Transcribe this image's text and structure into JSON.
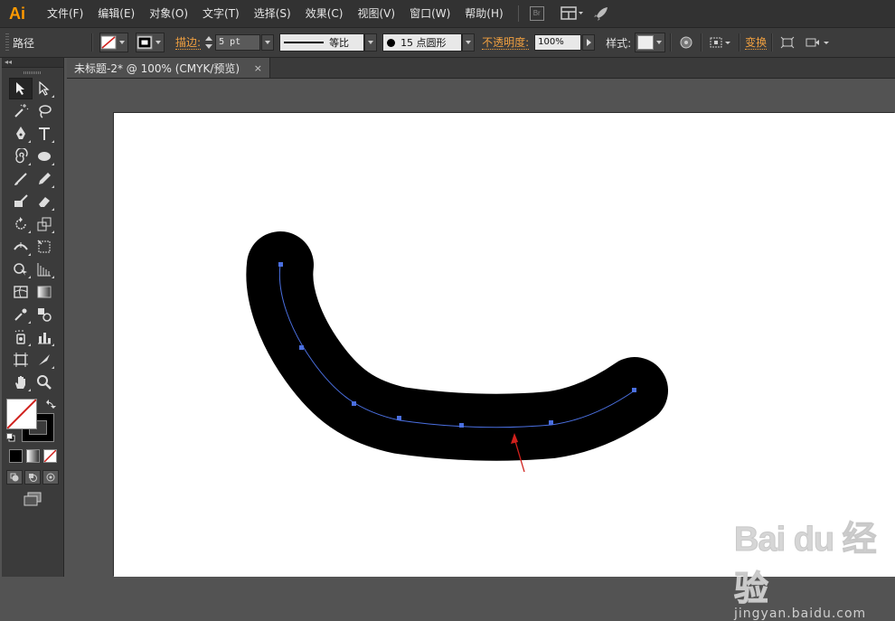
{
  "app": {
    "logo": "Ai"
  },
  "menu": [
    "文件(F)",
    "编辑(E)",
    "对象(O)",
    "文字(T)",
    "选择(S)",
    "效果(C)",
    "视图(V)",
    "窗口(W)",
    "帮助(H)"
  ],
  "menubar_buttons": {
    "bridge": "Br"
  },
  "control": {
    "selection_label": "路径",
    "stroke_label": "描边:",
    "stroke_value": "5 pt",
    "profile_label": "等比",
    "brush_label": "15 点圆形",
    "opacity_label": "不透明度:",
    "opacity_value": "100%",
    "style_label": "样式:",
    "transform_label": "变换"
  },
  "document": {
    "tab_title": "未标题-2* @ 100% (CMYK/预览)",
    "close": "×"
  },
  "toolbar": {
    "collapse": "◂◂"
  },
  "colors": {
    "accent": "#f0a040",
    "anchor": "#4a6fe0",
    "path_stroke": "#000000",
    "arrow": "#d0201c"
  },
  "watermark": {
    "main": "Bai du 经验",
    "url": "jingyan.baidu.com"
  }
}
